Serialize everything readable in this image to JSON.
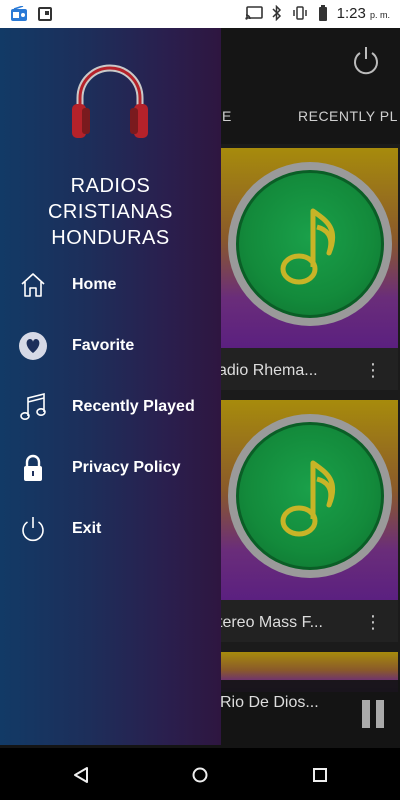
{
  "status_bar": {
    "time": "1:23",
    "ampm": "p. m.",
    "icons": [
      "radio-app-icon",
      "screenshot-icon",
      "cast-icon",
      "bluetooth-icon",
      "vibrate-icon",
      "battery-icon"
    ]
  },
  "drawer": {
    "title_lines": [
      "RADIOS",
      "CRISTIANAS",
      "HONDURAS"
    ],
    "items": [
      {
        "label": "Home",
        "icon": "home-icon"
      },
      {
        "label": "Favorite",
        "icon": "heart-icon"
      },
      {
        "label": "Recently Played",
        "icon": "music-notes-icon"
      },
      {
        "label": "Privacy Policy",
        "icon": "lock-icon"
      },
      {
        "label": "Exit",
        "icon": "power-icon"
      }
    ]
  },
  "app": {
    "tabs": [
      "E",
      "RECENTLY PL"
    ],
    "cards": [
      {
        "title": "adio Rhema..."
      },
      {
        "title": "tereo Mass  F..."
      }
    ],
    "player": {
      "title": "Rio De Dios..."
    }
  },
  "colors": {
    "accent_green": "#138a3b",
    "logo_red": "#b5222a",
    "drawer_left": "#123a66",
    "drawer_right": "#2e1640"
  }
}
